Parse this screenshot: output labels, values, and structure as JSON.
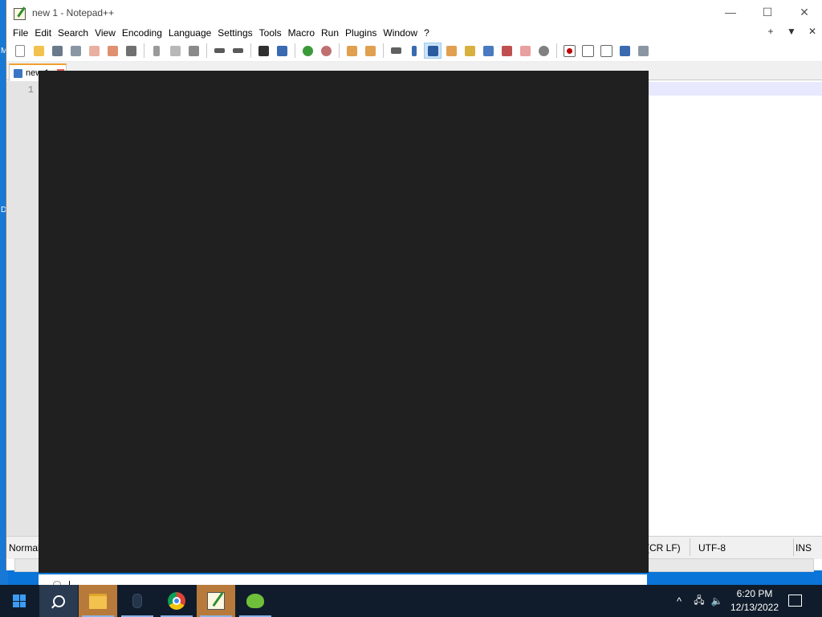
{
  "desktop": {
    "edge_chars": [
      "M",
      "D"
    ]
  },
  "window": {
    "title": "new 1 - Notepad++",
    "controls": {
      "minimize": "—",
      "maximize": "☐",
      "close": "✕"
    }
  },
  "menu": {
    "items": [
      "File",
      "Edit",
      "Search",
      "View",
      "Encoding",
      "Language",
      "Settings",
      "Tools",
      "Macro",
      "Run",
      "Plugins",
      "Window",
      "?"
    ],
    "right": {
      "add": "+",
      "dropdown": "▼",
      "close": "✕"
    }
  },
  "tab": {
    "label": "new 1"
  },
  "editor": {
    "line_number": "1"
  },
  "status": {
    "language": "Normal text file",
    "eol": "Windows (CR LF)",
    "encoding": "UTF-8",
    "mode": "INS"
  },
  "taskbar": {
    "clock_time": "6:20 PM",
    "clock_date": "12/13/2022",
    "tray_chevron": "^",
    "tray_network": "🖧",
    "tray_volume": "🔈"
  }
}
